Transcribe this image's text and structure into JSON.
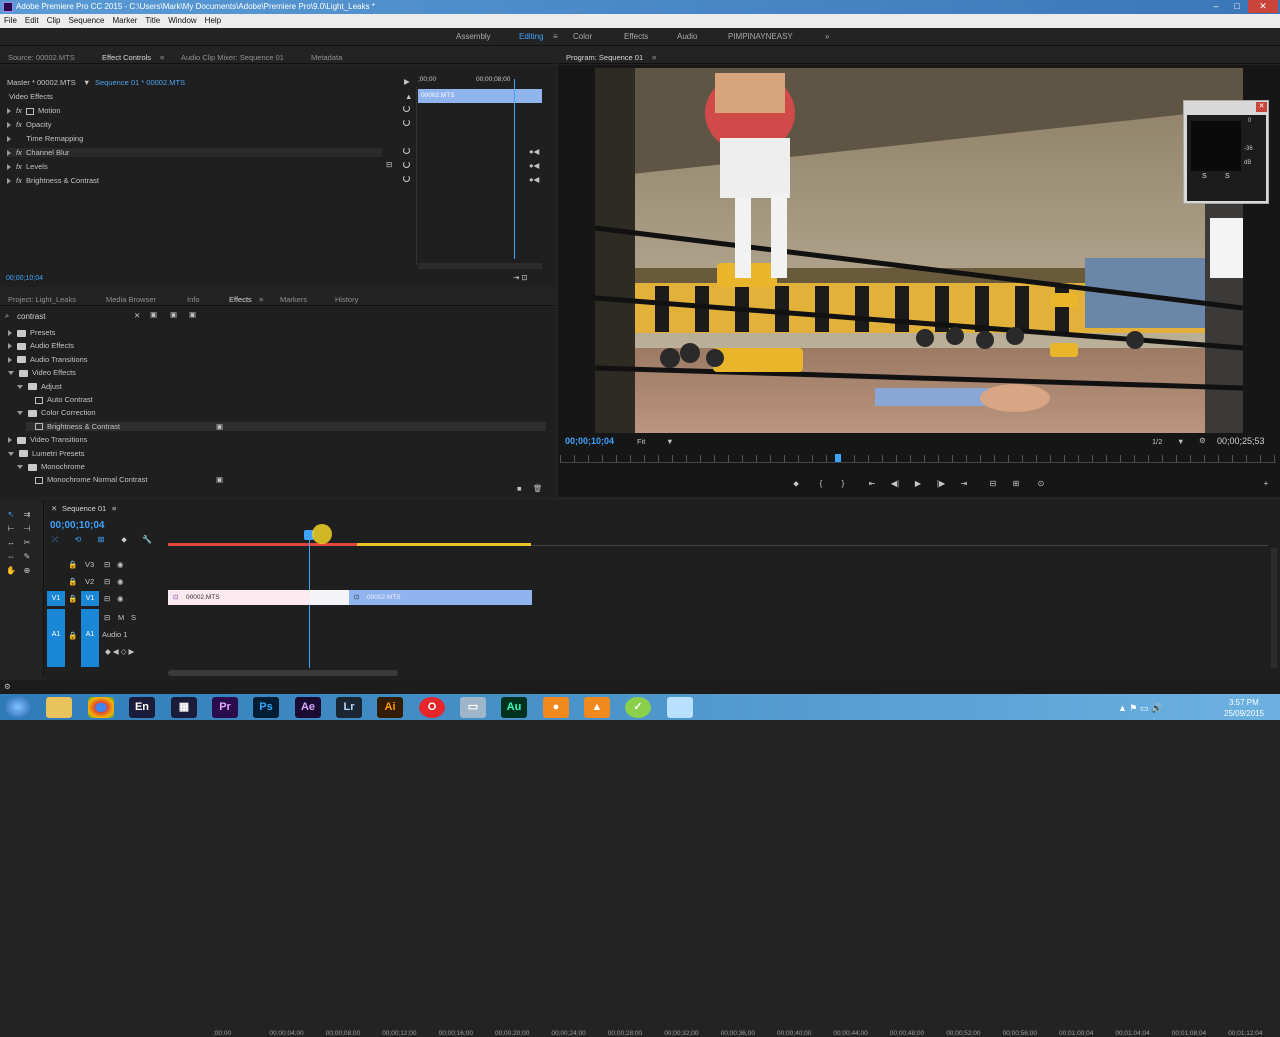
{
  "window": {
    "title": "Adobe Premiere Pro CC 2015 - C:\\Users\\Mark\\My Documents\\Adobe\\Premiere Pro\\9.0\\Light_Leaks *"
  },
  "menu": [
    "File",
    "Edit",
    "Clip",
    "Sequence",
    "Marker",
    "Title",
    "Window",
    "Help"
  ],
  "workspaces": [
    "Assembly",
    "Editing",
    "Color",
    "Effects",
    "Audio",
    "PIMPINAYNEASY"
  ],
  "source_tabs": [
    "Source: 00002.MTS",
    "Effect Controls",
    "Audio Clip Mixer: Sequence 01",
    "Metadata"
  ],
  "effect_controls": {
    "master": "Master * 00002.MTS",
    "sequence": "Sequence 01 * 00002.MTS",
    "ruler_start": ";00;00",
    "ruler_mid": "00;00;08;00",
    "clip_label": "00002.MTS",
    "section": "Video Effects",
    "effects": [
      "Motion",
      "Opacity",
      "Time Remapping",
      "Channel Blur",
      "Levels",
      "Brightness & Contrast"
    ],
    "timecode": "00;00;10;04"
  },
  "project_tabs": [
    "Project: Light_Leaks",
    "Media Browser",
    "Info",
    "Effects",
    "Markers",
    "History"
  ],
  "effects_panel": {
    "search_value": "contrast",
    "tree": [
      {
        "label": "Presets",
        "level": 0,
        "open": false
      },
      {
        "label": "Audio Effects",
        "level": 0,
        "open": false
      },
      {
        "label": "Audio Transitions",
        "level": 0,
        "open": false
      },
      {
        "label": "Video Effects",
        "level": 0,
        "open": true
      },
      {
        "label": "Adjust",
        "level": 1,
        "open": true
      },
      {
        "label": "Auto Contrast",
        "level": 2,
        "fx": true
      },
      {
        "label": "Color Correction",
        "level": 1,
        "open": true
      },
      {
        "label": "Brightness & Contrast",
        "level": 2,
        "fx": true,
        "selected": true
      },
      {
        "label": "Video Transitions",
        "level": 0,
        "open": false
      },
      {
        "label": "Lumetri Presets",
        "level": 0,
        "open": true
      },
      {
        "label": "Monochrome",
        "level": 1,
        "open": true
      },
      {
        "label": "Monochrome Normal Contrast",
        "level": 2,
        "fx": true
      }
    ]
  },
  "program": {
    "title": "Program: Sequence 01",
    "timecode": "00;00;10;04",
    "fit": "Fit",
    "resolution": "1/2",
    "duration": "00;00;25;53",
    "meter_labels": [
      "0",
      "-36",
      "dB"
    ],
    "meter_s": [
      "S",
      "S"
    ]
  },
  "sequence": {
    "name": "Sequence 01",
    "timecode": "00;00;10;04",
    "ticks": [
      ";00;00",
      "00;00;04;00",
      "00;00;08;00",
      "00;00;12;00",
      "00;00;16;00",
      "00;00;20;00",
      "00;00;24;00",
      "00;00;28;00",
      "00;00;32;00",
      "00;00;36;00",
      "00;00;40;00",
      "00;00;44;00",
      "00;00;48;00",
      "00;00;52;00",
      "00;00;56;00",
      "00;01;00;04",
      "00;01;04;04",
      "00;01;08;04",
      "00;01;12;04",
      "00;01;16;04"
    ],
    "tracks": [
      "V3",
      "V2",
      "V1",
      "A1"
    ],
    "audio_track_name": "Audio 1",
    "clip1": "00002.MTS",
    "clip2": "00002.MTS"
  },
  "taskbar": {
    "time": "3:57 PM",
    "date": "25/09/2015",
    "apps": [
      "En",
      "Pr",
      "Ps",
      "Ae",
      "Lr",
      "Ai",
      "Au"
    ]
  },
  "colors": {
    "accent": "#3ea3ff",
    "clip_blue": "#8fb4ee",
    "clip_pink": "#fdeaf0",
    "panel": "#232323"
  }
}
